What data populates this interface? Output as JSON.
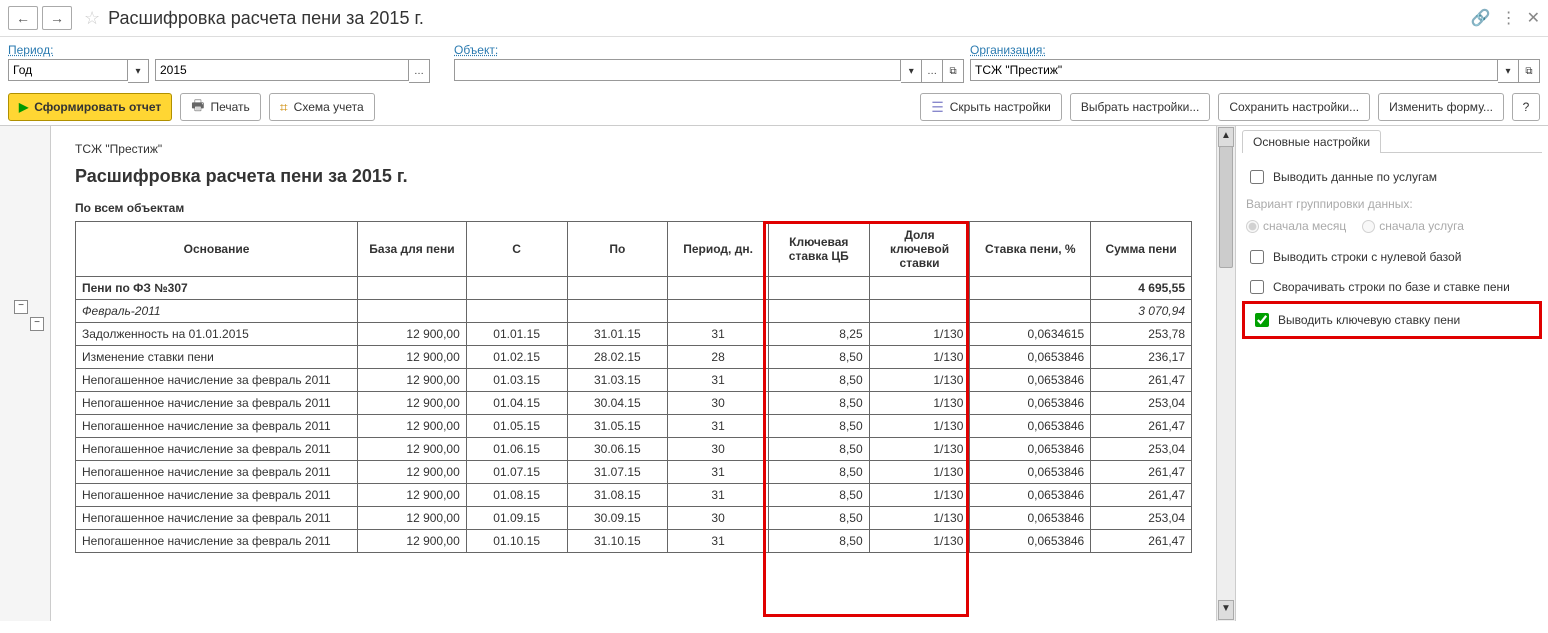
{
  "header": {
    "title": "Расшифровка расчета пени  за 2015 г."
  },
  "filters": {
    "period_label": "Период:",
    "period_type": "Год",
    "period_value": "2015",
    "object_label": "Объект:",
    "object_value": "",
    "org_label": "Организация:",
    "org_value": "ТСЖ \"Престиж\""
  },
  "toolbar": {
    "form_report": "Сформировать отчет",
    "print": "Печать",
    "scheme": "Схема учета",
    "hide_settings": "Скрыть настройки",
    "choose_settings": "Выбрать настройки...",
    "save_settings": "Сохранить настройки...",
    "change_form": "Изменить форму...",
    "help": "?"
  },
  "report": {
    "org_head": "ТСЖ \"Престиж\"",
    "title": "Расшифровка расчета пени за 2015 г.",
    "subtitle": "По всем объектам",
    "headers": {
      "basis": "Основание",
      "base": "База для пени",
      "from": "С",
      "to": "По",
      "period": "Период, дн.",
      "keyrate": "Ключевая ставка ЦБ",
      "keyshare": "Доля ключевой ставки",
      "rate": "Ставка пени, %",
      "sum": "Сумма пени"
    },
    "group1": "Пени по ФЗ №307",
    "group1_sum": "4 695,55",
    "group2": "Февраль-2011",
    "group2_sum": "3 070,94",
    "rows": [
      {
        "basis": "Задолженность на 01.01.2015",
        "base": "12 900,00",
        "from": "01.01.15",
        "to": "31.01.15",
        "period": "31",
        "keyrate": "8,25",
        "keyshare": "1/130",
        "rate": "0,0634615",
        "sum": "253,78"
      },
      {
        "basis": "Изменение ставки пени",
        "base": "12 900,00",
        "from": "01.02.15",
        "to": "28.02.15",
        "period": "28",
        "keyrate": "8,50",
        "keyshare": "1/130",
        "rate": "0,0653846",
        "sum": "236,17"
      },
      {
        "basis": "Непогашенное начисление за февраль 2011",
        "base": "12 900,00",
        "from": "01.03.15",
        "to": "31.03.15",
        "period": "31",
        "keyrate": "8,50",
        "keyshare": "1/130",
        "rate": "0,0653846",
        "sum": "261,47"
      },
      {
        "basis": "Непогашенное начисление за февраль 2011",
        "base": "12 900,00",
        "from": "01.04.15",
        "to": "30.04.15",
        "period": "30",
        "keyrate": "8,50",
        "keyshare": "1/130",
        "rate": "0,0653846",
        "sum": "253,04"
      },
      {
        "basis": "Непогашенное начисление за февраль 2011",
        "base": "12 900,00",
        "from": "01.05.15",
        "to": "31.05.15",
        "period": "31",
        "keyrate": "8,50",
        "keyshare": "1/130",
        "rate": "0,0653846",
        "sum": "261,47"
      },
      {
        "basis": "Непогашенное начисление за февраль 2011",
        "base": "12 900,00",
        "from": "01.06.15",
        "to": "30.06.15",
        "period": "30",
        "keyrate": "8,50",
        "keyshare": "1/130",
        "rate": "0,0653846",
        "sum": "253,04"
      },
      {
        "basis": "Непогашенное начисление за февраль 2011",
        "base": "12 900,00",
        "from": "01.07.15",
        "to": "31.07.15",
        "period": "31",
        "keyrate": "8,50",
        "keyshare": "1/130",
        "rate": "0,0653846",
        "sum": "261,47"
      },
      {
        "basis": "Непогашенное начисление за февраль 2011",
        "base": "12 900,00",
        "from": "01.08.15",
        "to": "31.08.15",
        "period": "31",
        "keyrate": "8,50",
        "keyshare": "1/130",
        "rate": "0,0653846",
        "sum": "261,47"
      },
      {
        "basis": "Непогашенное начисление за февраль 2011",
        "base": "12 900,00",
        "from": "01.09.15",
        "to": "30.09.15",
        "period": "30",
        "keyrate": "8,50",
        "keyshare": "1/130",
        "rate": "0,0653846",
        "sum": "253,04"
      },
      {
        "basis": "Непогашенное начисление за февраль 2011",
        "base": "12 900,00",
        "from": "01.10.15",
        "to": "31.10.15",
        "period": "31",
        "keyrate": "8,50",
        "keyshare": "1/130",
        "rate": "0,0653846",
        "sum": "261,47"
      }
    ]
  },
  "settings": {
    "tab": "Основные настройки",
    "by_service": "Выводить данные по услугам",
    "group_label": "Вариант группировки данных:",
    "month_first": "сначала месяц",
    "service_first": "сначала услуга",
    "zero_base": "Выводить строки с нулевой базой",
    "collapse": "Сворачивать строки по базе и ставке пени",
    "key_rate": "Выводить ключевую ставку пени"
  }
}
